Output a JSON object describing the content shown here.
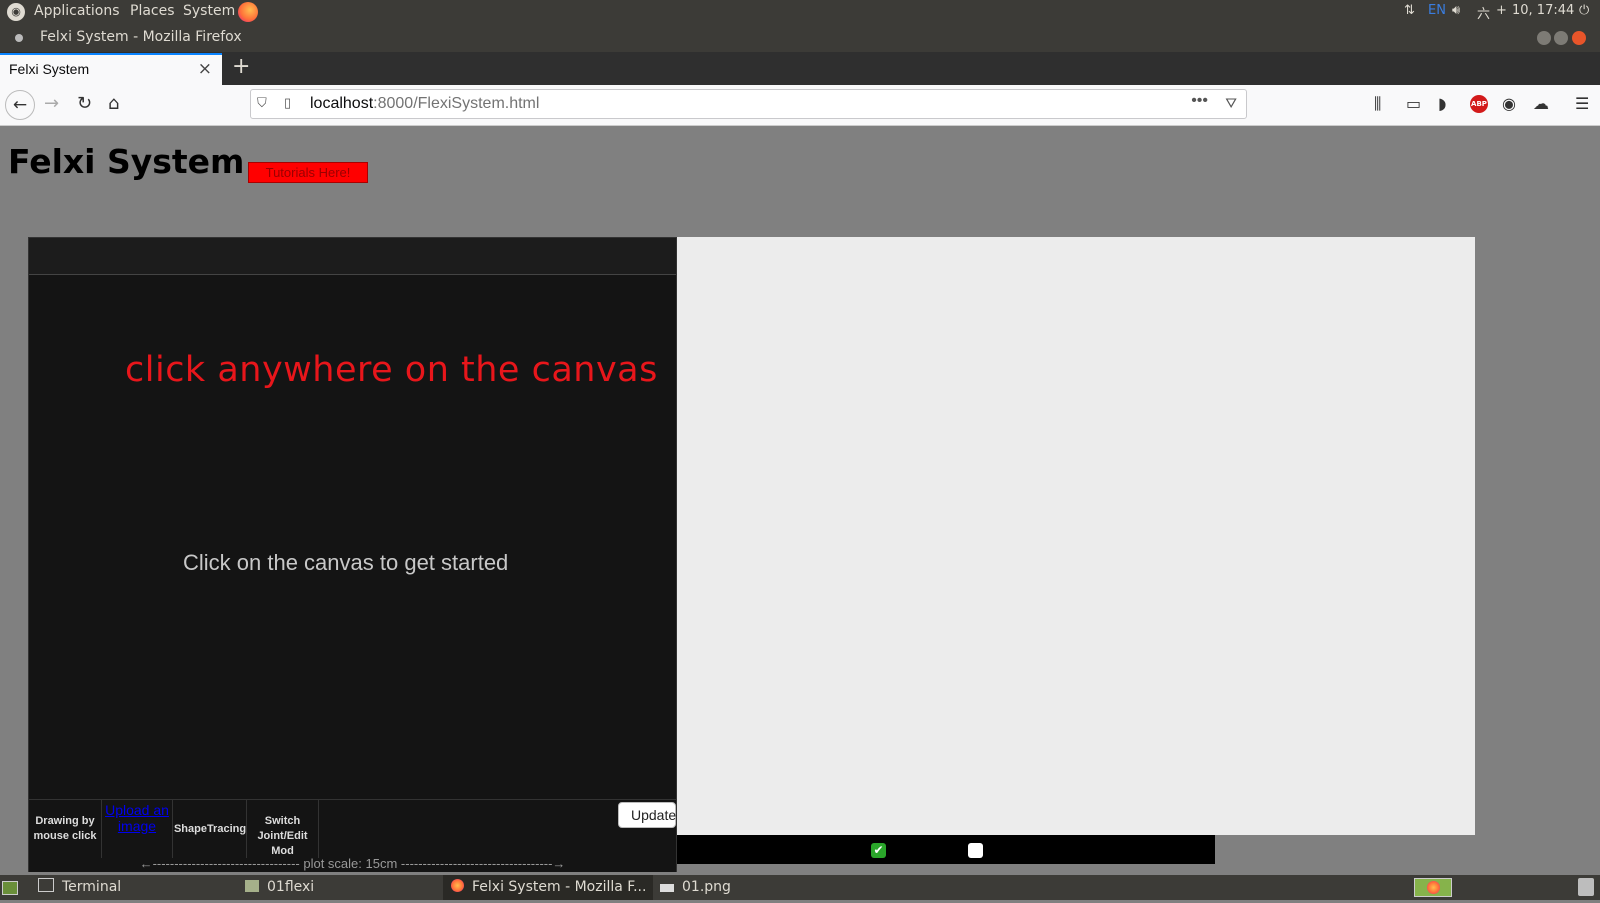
{
  "top_panel": {
    "applications": "Applications",
    "places": "Places",
    "system": "System",
    "clock": "10, 17:44",
    "keyboard_layout": "EN",
    "chinese_char": "六"
  },
  "window": {
    "title": "Felxi System - Mozilla Firefox"
  },
  "tabs": [
    {
      "label": "Felxi System",
      "close": "×"
    }
  ],
  "browser": {
    "url_host": "localhost",
    "url_path": ":8000/FlexiSystem.html",
    "more_icon": "•••"
  },
  "page": {
    "title": "Felxi System",
    "tutorials_label": "Tutorials Here!",
    "canvas_hint": "click anywhere on the canvas",
    "canvas_start": "Click on the canvas to get started",
    "tools": [
      "Drawing by mouse click",
      "Upload an image",
      "ShapeTracing",
      "Switch Joint/Edit Mod"
    ],
    "update_label": "Update",
    "plot_scale": "←---------------------------------- plot scale: 15cm -----------------------------------→",
    "checkbox_1_checked": true,
    "checkbox_2_checked": false
  },
  "taskbar": [
    {
      "label": "Terminal"
    },
    {
      "label": "01flexi"
    },
    {
      "label": "Felxi System - Mozilla F..."
    },
    {
      "label": "01.png"
    }
  ],
  "colors": {
    "panel": "#3c3b37",
    "page_bg": "#808080",
    "canvas_bg": "#141414",
    "hint_red": "#e8161b",
    "tutorials_red": "#ff0000",
    "firefox_accent": "#0a84ff"
  }
}
